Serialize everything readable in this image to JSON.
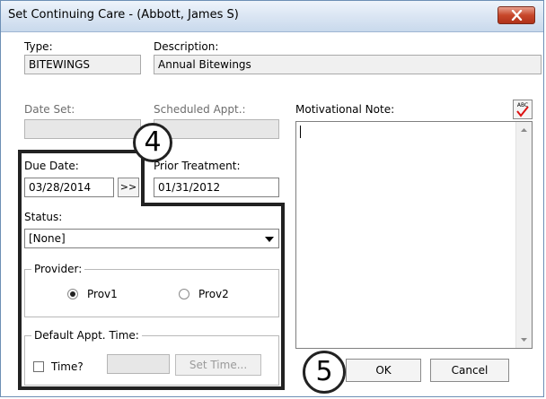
{
  "window": {
    "title": "Set Continuing Care - (Abbott, James S)",
    "close_icon": "close-icon"
  },
  "form": {
    "type_label": "Type:",
    "type_value": "BITEWINGS",
    "description_label": "Description:",
    "description_value": "Annual Bitewings",
    "date_set_label": "Date Set:",
    "date_set_value": "",
    "scheduled_appt_label": "Scheduled Appt.:",
    "scheduled_appt_value": "",
    "due_date_label": "Due Date:",
    "due_date_value": "03/28/2014",
    "due_date_button": ">>",
    "prior_treatment_label": "Prior Treatment:",
    "prior_treatment_value": "01/31/2012",
    "status_label": "Status:",
    "status_value": "[None]",
    "motivational_note_label": "Motivational Note:",
    "motivational_note_value": "",
    "spellcheck_icon": "spellcheck-icon",
    "spellcheck_text": "ABC"
  },
  "provider": {
    "legend": "Provider:",
    "options": [
      {
        "label": "Prov1",
        "selected": true
      },
      {
        "label": "Prov2",
        "selected": false
      }
    ]
  },
  "default_time": {
    "legend": "Default Appt. Time:",
    "time_checkbox_label": "Time?",
    "time_checked": false,
    "time_value": "",
    "set_time_button": "Set Time..."
  },
  "buttons": {
    "ok": "OK",
    "cancel": "Cancel"
  },
  "callouts": {
    "step4": "4",
    "step5": "5"
  }
}
